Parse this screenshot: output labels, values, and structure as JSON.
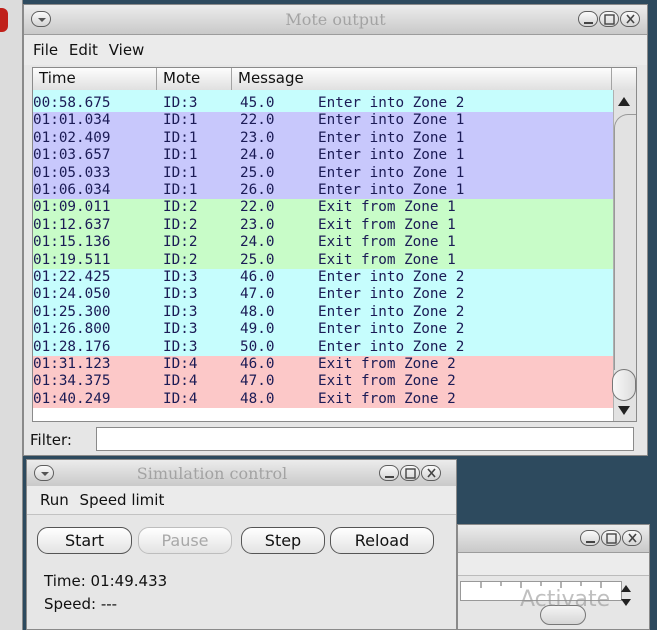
{
  "mote_output": {
    "title": "Mote output",
    "menu": [
      "File",
      "Edit",
      "View"
    ],
    "columns": [
      "Time",
      "Mote",
      "Message"
    ],
    "colors": {
      "zone2_enter": "#c6fdfd",
      "zone1_enter": "#c8c8fc",
      "zone1_exit": "#c8fcc8",
      "zone2_exit": "#fcc8c8"
    },
    "rows": [
      {
        "time": "00:58.675",
        "mote": "ID:3",
        "value": "45.0",
        "message": "Enter into Zone 2",
        "color": "#c6fdfd"
      },
      {
        "time": "01:01.034",
        "mote": "ID:1",
        "value": "22.0",
        "message": "Enter into Zone 1",
        "color": "#c8c8fc"
      },
      {
        "time": "01:02.409",
        "mote": "ID:1",
        "value": "23.0",
        "message": "Enter into Zone 1",
        "color": "#c8c8fc"
      },
      {
        "time": "01:03.657",
        "mote": "ID:1",
        "value": "24.0",
        "message": "Enter into Zone 1",
        "color": "#c8c8fc"
      },
      {
        "time": "01:05.033",
        "mote": "ID:1",
        "value": "25.0",
        "message": "Enter into Zone 1",
        "color": "#c8c8fc"
      },
      {
        "time": "01:06.034",
        "mote": "ID:1",
        "value": "26.0",
        "message": "Enter into Zone 1",
        "color": "#c8c8fc"
      },
      {
        "time": "01:09.011",
        "mote": "ID:2",
        "value": "22.0",
        "message": "Exit from Zone 1",
        "color": "#c8fcc8"
      },
      {
        "time": "01:12.637",
        "mote": "ID:2",
        "value": "23.0",
        "message": "Exit from Zone 1",
        "color": "#c8fcc8"
      },
      {
        "time": "01:15.136",
        "mote": "ID:2",
        "value": "24.0",
        "message": "Exit from Zone 1",
        "color": "#c8fcc8"
      },
      {
        "time": "01:19.511",
        "mote": "ID:2",
        "value": "25.0",
        "message": "Exit from Zone 1",
        "color": "#c8fcc8"
      },
      {
        "time": "01:22.425",
        "mote": "ID:3",
        "value": "46.0",
        "message": "Enter into Zone 2",
        "color": "#c6fdfd"
      },
      {
        "time": "01:24.050",
        "mote": "ID:3",
        "value": "47.0",
        "message": "Enter into Zone 2",
        "color": "#c6fdfd"
      },
      {
        "time": "01:25.300",
        "mote": "ID:3",
        "value": "48.0",
        "message": "Enter into Zone 2",
        "color": "#c6fdfd"
      },
      {
        "time": "01:26.800",
        "mote": "ID:3",
        "value": "49.0",
        "message": "Enter into Zone 2",
        "color": "#c6fdfd"
      },
      {
        "time": "01:28.176",
        "mote": "ID:3",
        "value": "50.0",
        "message": "Enter into Zone 2",
        "color": "#c6fdfd"
      },
      {
        "time": "01:31.123",
        "mote": "ID:4",
        "value": "46.0",
        "message": "Exit from Zone 2",
        "color": "#fcc8c8"
      },
      {
        "time": "01:34.375",
        "mote": "ID:4",
        "value": "47.0",
        "message": "Exit from Zone 2",
        "color": "#fcc8c8"
      },
      {
        "time": "01:40.249",
        "mote": "ID:4",
        "value": "48.0",
        "message": "Exit from Zone 2",
        "color": "#fcc8c8"
      }
    ],
    "filter_label": "Filter:",
    "filter_value": ""
  },
  "simulation_control": {
    "title": "Simulation control",
    "menu": [
      "Run",
      "Speed limit"
    ],
    "buttons": {
      "start": "Start",
      "pause": "Pause",
      "step": "Step",
      "reload": "Reload"
    },
    "time_label": "Time: 01:49.433",
    "speed_label": "Speed: ---"
  },
  "background_window": {
    "watermark": "Activate"
  }
}
